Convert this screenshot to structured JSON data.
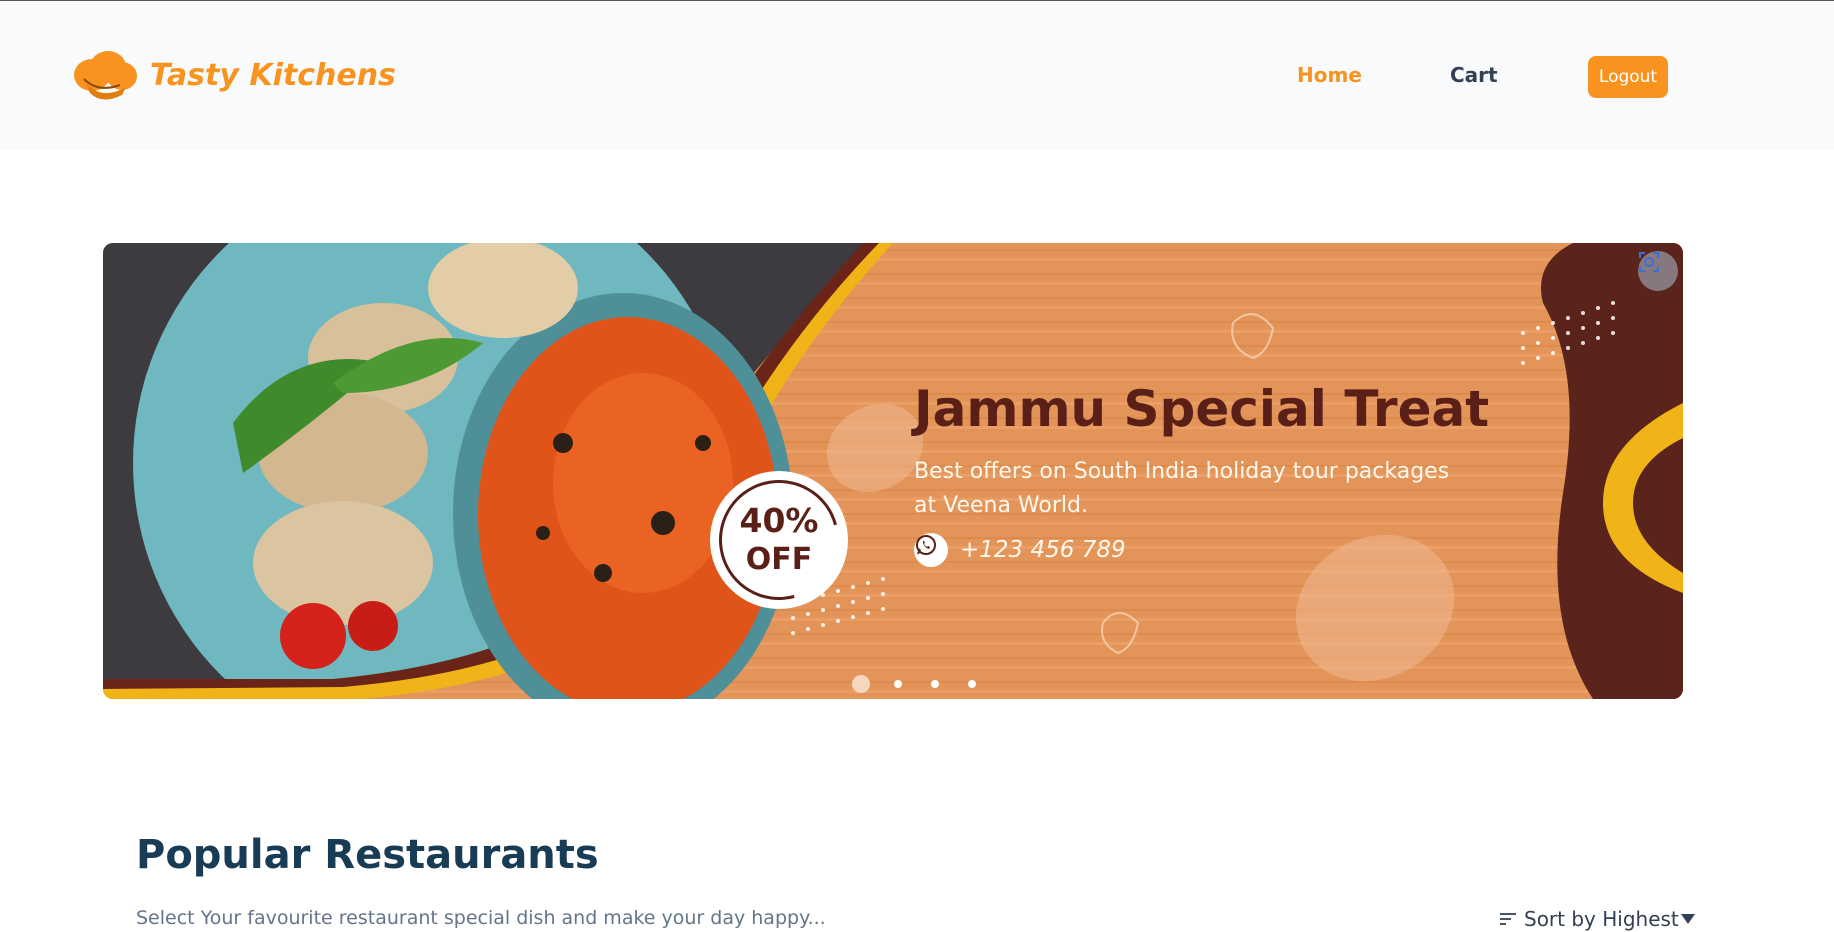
{
  "app": {
    "brand_name": "Tasty Kitchens",
    "brand_color": "#f7931e"
  },
  "nav": {
    "home_label": "Home",
    "cart_label": "Cart",
    "logout_label": "Logout"
  },
  "banner": {
    "title": "Jammu Special Treat",
    "description": "Best offers on South India holiday tour packages at Veena World.",
    "phone": "+123 456 789",
    "discount_percent": "40%",
    "discount_word": "OFF",
    "carousel_slide_count": 4,
    "carousel_active_index": 0
  },
  "popular": {
    "title": "Popular Restaurants",
    "subtitle": "Select Your favourite restaurant special dish and make your day happy...",
    "sort_label": "Sort by Highest"
  },
  "icons": {
    "logo": "chef-hat-icon",
    "whatsapp": "whatsapp-icon",
    "scan": "scan-icon",
    "sort": "sort-lines-icon",
    "caret": "caret-down-icon"
  }
}
